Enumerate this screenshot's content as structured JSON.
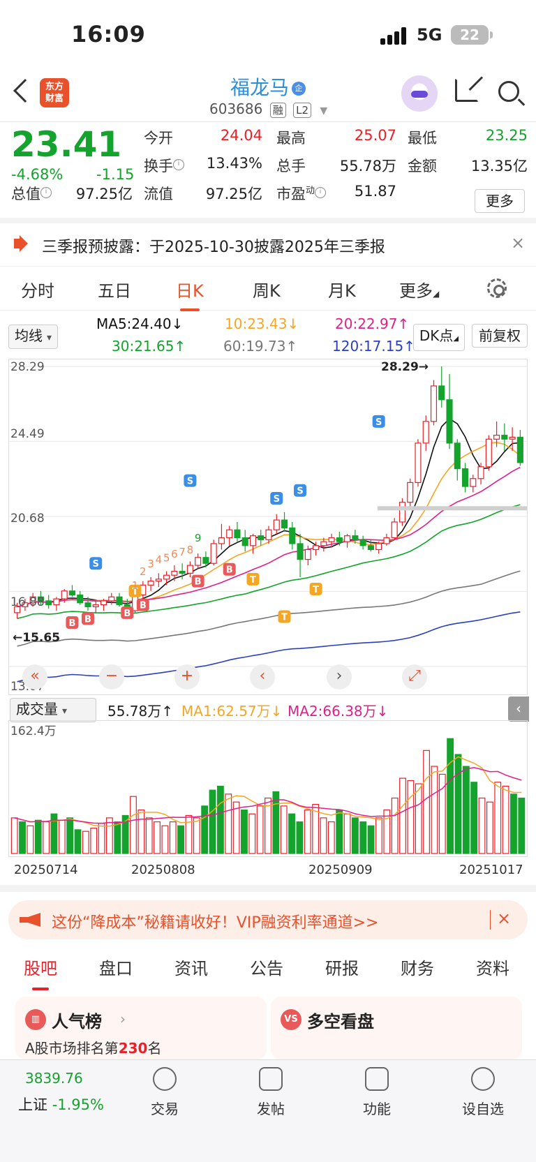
{
  "status": {
    "time": "16:09",
    "network": "5G",
    "battery": "22"
  },
  "header": {
    "logo_line1": "东方",
    "logo_line2": "财富",
    "stock_name": "福龙马",
    "name_badge": "企",
    "stock_code": "603686",
    "tag1": "融",
    "tag2": "L2"
  },
  "quote": {
    "price": "23.41",
    "change_pct": "-4.68%",
    "change": "-1.15",
    "open_label": "今开",
    "open": "24.04",
    "high_label": "最高",
    "high": "25.07",
    "low_label": "最低",
    "low": "23.25",
    "turnover_label": "换手",
    "turnover": "13.43%",
    "vol_label": "总手",
    "vol": "55.78万",
    "amount_label": "金额",
    "amount": "13.35亿",
    "mcap_label": "总值",
    "mcap": "97.25亿",
    "float_label": "流值",
    "float": "97.25亿",
    "pe_label": "市盈",
    "pe_sup": "动",
    "pe": "51.87",
    "more": "更多"
  },
  "notice": {
    "text": "三季报预披露：于2025-10-30披露2025年三季报",
    "close": "×"
  },
  "chart_tabs": [
    "分时",
    "五日",
    "日K",
    "周K",
    "月K",
    "更多"
  ],
  "ma_bar": {
    "selector": "均线",
    "ma5": "MA5:24.40↓",
    "ma10": "10:23.43↓",
    "ma20": "20:22.97↑",
    "ma30": "30:21.65↑",
    "ma60": "60:19.73↑",
    "ma120": "120:17.15↑",
    "dk_btn": "DK点",
    "fq_btn": "前复权"
  },
  "colors": {
    "up": "#e8202a",
    "down": "#14a32c",
    "ma5": "#111111",
    "ma10": "#f5a623",
    "ma20": "#e0208a",
    "ma30": "#14a32c",
    "ma60": "#777777",
    "ma120": "#2a3fbf",
    "accent": "#e8512a"
  },
  "chart_data": {
    "type": "candlestick",
    "y_ticks": [
      "28.29",
      "24.49",
      "20.68",
      "16.88",
      "13.07"
    ],
    "ylim": [
      13.07,
      28.29
    ],
    "max_label": "28.29",
    "min_label": "15.65",
    "x_ticks": [
      "20250714",
      "20250808",
      "20250909",
      "20251017"
    ],
    "candles": [
      [
        15.8,
        16.3,
        15.5,
        16.1
      ],
      [
        16.1,
        16.5,
        15.9,
        16.3
      ],
      [
        16.3,
        16.8,
        16.1,
        16.6
      ],
      [
        16.6,
        16.9,
        16.2,
        16.4
      ],
      [
        16.4,
        16.7,
        16.0,
        16.2
      ],
      [
        16.2,
        16.6,
        15.9,
        16.5
      ],
      [
        16.5,
        17.0,
        16.3,
        16.9
      ],
      [
        16.9,
        17.2,
        16.6,
        16.7
      ],
      [
        16.7,
        16.9,
        16.2,
        16.3
      ],
      [
        16.3,
        16.6,
        15.9,
        16.1
      ],
      [
        16.1,
        16.4,
        15.8,
        16.2
      ],
      [
        16.2,
        16.5,
        15.9,
        16.4
      ],
      [
        16.4,
        16.8,
        16.2,
        16.6
      ],
      [
        16.6,
        16.8,
        16.1,
        16.2
      ],
      [
        16.2,
        16.5,
        15.7,
        15.9
      ],
      [
        15.9,
        16.8,
        15.8,
        16.7
      ],
      [
        16.7,
        17.4,
        16.5,
        17.2
      ],
      [
        17.2,
        17.6,
        16.9,
        17.4
      ],
      [
        17.4,
        17.8,
        17.1,
        17.5
      ],
      [
        17.5,
        17.9,
        17.2,
        17.7
      ],
      [
        17.7,
        18.2,
        17.4,
        17.9
      ],
      [
        17.9,
        18.3,
        17.5,
        17.8
      ],
      [
        17.8,
        18.4,
        17.6,
        18.2
      ],
      [
        18.2,
        18.8,
        18.0,
        18.6
      ],
      [
        18.6,
        18.9,
        18.1,
        18.3
      ],
      [
        18.3,
        19.5,
        18.2,
        19.3
      ],
      [
        19.3,
        20.3,
        19.0,
        19.6
      ],
      [
        19.6,
        20.2,
        19.2,
        20.0
      ],
      [
        20.0,
        20.4,
        19.4,
        19.6
      ],
      [
        19.6,
        20.0,
        18.9,
        19.2
      ],
      [
        19.2,
        19.8,
        18.8,
        19.7
      ],
      [
        19.7,
        20.0,
        19.2,
        19.5
      ],
      [
        19.5,
        20.2,
        19.3,
        20.0
      ],
      [
        20.0,
        20.8,
        19.8,
        20.5
      ],
      [
        20.5,
        20.9,
        19.9,
        20.1
      ],
      [
        20.1,
        20.4,
        19.0,
        19.3
      ],
      [
        19.3,
        19.8,
        17.6,
        18.5
      ],
      [
        18.5,
        19.2,
        18.2,
        19.0
      ],
      [
        19.0,
        19.4,
        18.7,
        19.2
      ],
      [
        19.2,
        19.6,
        18.9,
        19.4
      ],
      [
        19.4,
        19.8,
        19.1,
        19.6
      ],
      [
        19.6,
        19.9,
        19.2,
        19.4
      ],
      [
        19.4,
        19.8,
        19.1,
        19.7
      ],
      [
        19.7,
        20.0,
        19.3,
        19.5
      ],
      [
        19.5,
        19.7,
        19.0,
        19.2
      ],
      [
        19.2,
        19.5,
        18.9,
        19.0
      ],
      [
        19.0,
        19.4,
        18.8,
        19.3
      ],
      [
        19.3,
        19.8,
        19.2,
        19.6
      ],
      [
        19.6,
        20.6,
        19.5,
        20.4
      ],
      [
        20.4,
        21.6,
        20.2,
        21.4
      ],
      [
        21.4,
        22.6,
        21.0,
        22.4
      ],
      [
        22.4,
        24.6,
        22.2,
        24.4
      ],
      [
        24.4,
        25.8,
        24.0,
        25.5
      ],
      [
        25.5,
        27.6,
        25.3,
        27.3
      ],
      [
        27.3,
        28.29,
        26.2,
        26.6
      ],
      [
        26.6,
        27.9,
        24.1,
        24.4
      ],
      [
        24.4,
        24.6,
        22.5,
        23.1
      ],
      [
        23.1,
        23.4,
        21.9,
        22.2
      ],
      [
        22.2,
        22.8,
        21.9,
        22.6
      ],
      [
        22.6,
        23.4,
        22.3,
        23.2
      ],
      [
        23.2,
        24.8,
        23.0,
        24.6
      ],
      [
        24.6,
        25.5,
        24.2,
        24.8
      ],
      [
        24.8,
        25.4,
        24.0,
        24.6
      ],
      [
        24.6,
        25.2,
        24.0,
        24.7
      ],
      [
        24.7,
        25.07,
        23.25,
        23.41
      ]
    ],
    "markers": [
      "B",
      "B",
      "B",
      "B",
      "B",
      "B",
      "S",
      "S",
      "S",
      "S",
      "S",
      "T",
      "T",
      "T",
      "T",
      "1",
      "2",
      "3",
      "4",
      "5",
      "6",
      "7",
      "8",
      "9"
    ]
  },
  "volume": {
    "selector": "成交量",
    "value": "55.78万↑",
    "ma1": "MA1:62.57万↓",
    "ma2": "MA2:66.38万↓",
    "max_tick": "162.4万",
    "bars": [
      45,
      40,
      35,
      42,
      40,
      50,
      42,
      45,
      30,
      28,
      32,
      38,
      45,
      40,
      48,
      72,
      55,
      45,
      40,
      35,
      40,
      35,
      48,
      45,
      60,
      80,
      85,
      75,
      65,
      55,
      50,
      60,
      70,
      78,
      60,
      50,
      40,
      55,
      62,
      45,
      40,
      55,
      50,
      45,
      40,
      35,
      45,
      55,
      70,
      95,
      92,
      88,
      130,
      110,
      100,
      145,
      125,
      110,
      90,
      70,
      65,
      90,
      85,
      75,
      70
    ],
    "bar_up": [
      1,
      0,
      1,
      0,
      1,
      0,
      1,
      0,
      0,
      1,
      1,
      1,
      1,
      0,
      0,
      1,
      1,
      1,
      1,
      1,
      1,
      0,
      1,
      1,
      0,
      0,
      0,
      1,
      1,
      0,
      1,
      1,
      1,
      0,
      1,
      0,
      0,
      1,
      1,
      1,
      1,
      0,
      1,
      0,
      0,
      0,
      1,
      1,
      1,
      1,
      1,
      1,
      1,
      1,
      1,
      0,
      0,
      0,
      0,
      1,
      1,
      1,
      1,
      0,
      0
    ]
  },
  "promo": {
    "text": "这份“降成本”秘籍请收好！VIP融资利率通道>>",
    "close": "×"
  },
  "bottom_tabs": [
    "股吧",
    "盘口",
    "资讯",
    "公告",
    "研报",
    "财务",
    "资料"
  ],
  "cards": {
    "left_title": "人气榜",
    "left_sub_prefix": "A股市场排名第",
    "left_rank": "230",
    "left_sub_suffix": "名",
    "right_title": "多空看盘",
    "right_badge": "VS"
  },
  "footer": {
    "index_value": "3839.76",
    "index_name": "上证",
    "index_change": "-1.95%",
    "items": [
      "交易",
      "发帖",
      "功能",
      "设自选"
    ]
  }
}
